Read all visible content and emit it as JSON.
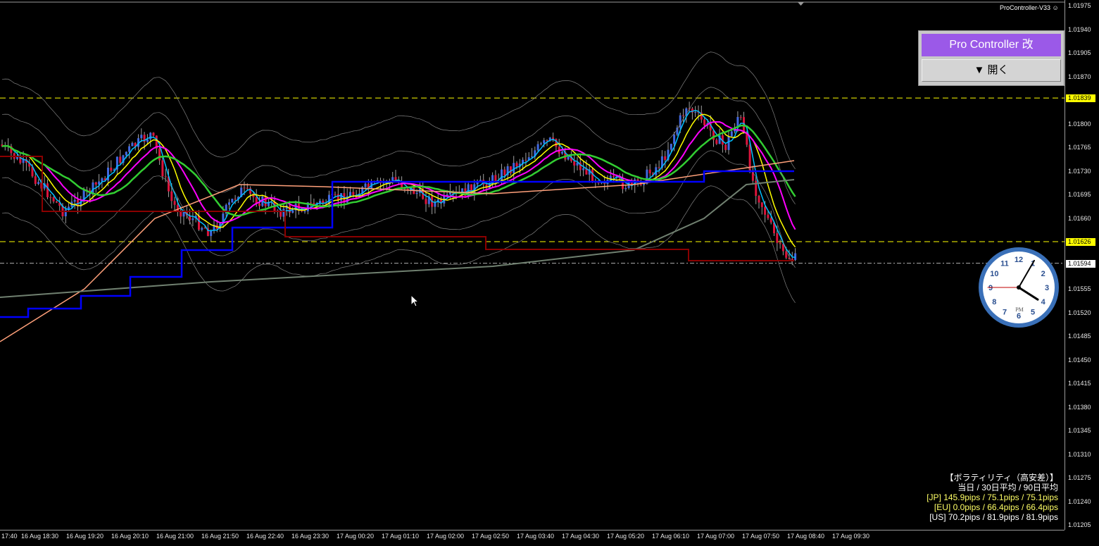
{
  "window": {
    "ea_label": "ProController-V33"
  },
  "price_axis": {
    "ticks": [
      "1.01975",
      "1.01940",
      "1.01905",
      "1.01870",
      "1.01835",
      "1.01800",
      "1.01765",
      "1.01730",
      "1.01695",
      "1.01660",
      "1.01625",
      "1.01590",
      "1.01555",
      "1.01520",
      "1.01485",
      "1.01450",
      "1.01415",
      "1.01380",
      "1.01345",
      "1.01310",
      "1.01275",
      "1.01240",
      "1.01205"
    ],
    "tags": [
      {
        "value": "1.01839",
        "bg": "#ffff00",
        "fg": "#000000"
      },
      {
        "value": "1.01626",
        "bg": "#ffff00",
        "fg": "#000000"
      },
      {
        "value": "1.01594",
        "bg": "#ffffff",
        "fg": "#000000"
      }
    ]
  },
  "time_axis": {
    "ticks": [
      "17:40",
      "16 Aug 18:30",
      "16 Aug 19:20",
      "16 Aug 20:10",
      "16 Aug 21:00",
      "16 Aug 21:50",
      "16 Aug 22:40",
      "16 Aug 23:30",
      "17 Aug 00:20",
      "17 Aug 01:10",
      "17 Aug 02:00",
      "17 Aug 02:50",
      "17 Aug 03:40",
      "17 Aug 04:30",
      "17 Aug 05:20",
      "17 Aug 06:10",
      "17 Aug 07:00",
      "17 Aug 07:50",
      "17 Aug 08:40",
      "17 Aug 09:30"
    ]
  },
  "pro_controller": {
    "title": "Pro Controller 改",
    "open_label": "▼ 開く"
  },
  "clock": {
    "numbers": [
      "12",
      "1",
      "2",
      "3",
      "4",
      "5",
      "6",
      "7",
      "8",
      "9",
      "10",
      "11"
    ],
    "period": "PM",
    "hour": 4,
    "minute": 5,
    "second": 45
  },
  "volatility": {
    "heading": "【ボラティリティ（高安差）】",
    "subheading": "当日 / 30日平均 / 90日平均",
    "rows": [
      {
        "text": "[JP] 145.9pips / 75.1pips / 75.1pips",
        "color": "#ffff66"
      },
      {
        "text": "[EU] 0.0pips / 66.4pips / 66.4pips",
        "color": "#ffff66"
      },
      {
        "text": "[US] 70.2pips / 81.9pips / 81.9pips",
        "color": "#ffffff"
      }
    ]
  },
  "colors": {
    "bull": "#4169e1",
    "bear": "#dc143c",
    "sma_fast": "#00bfff",
    "sma_mid": "#ffff00",
    "sma_slow": "#ff00ff",
    "ema_long": "#32cd32",
    "ema_xlong": "#ffa07a",
    "donchian_high": "#0000ff",
    "donchian_low": "#8b0000",
    "band": "#808080",
    "trend": "#708070"
  }
}
